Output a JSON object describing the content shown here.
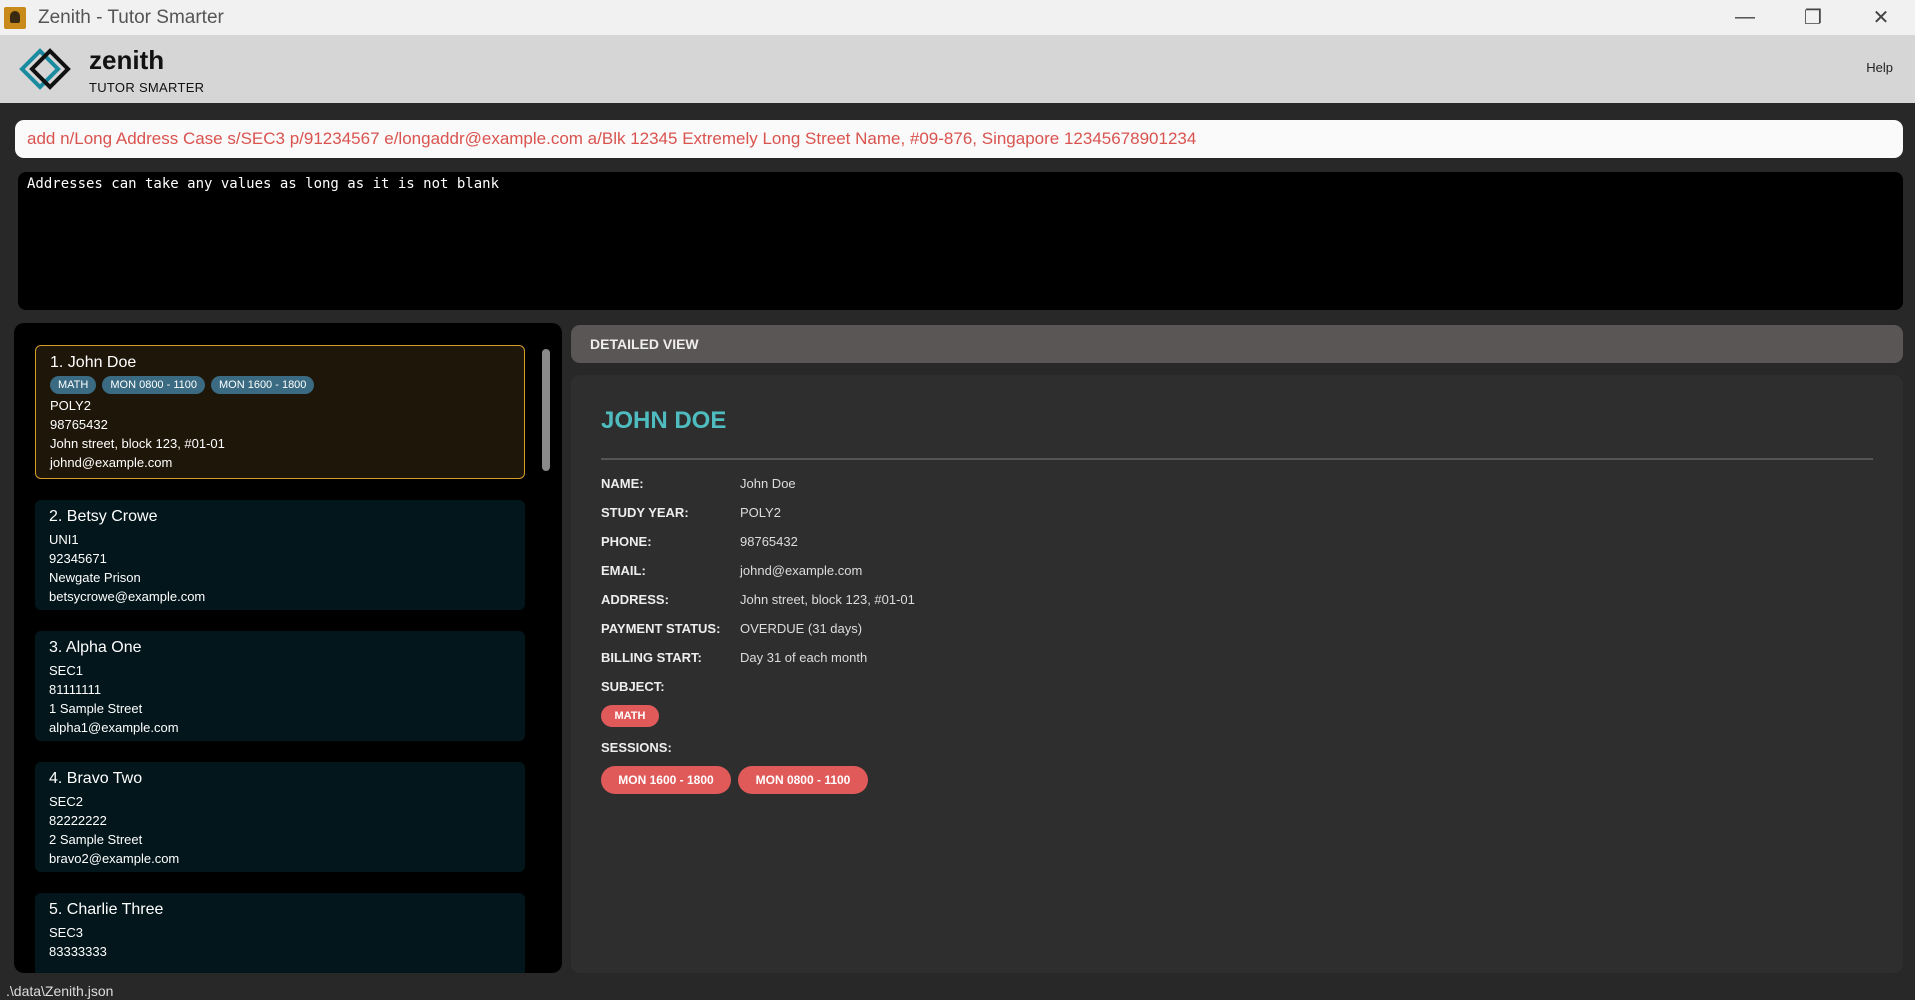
{
  "window": {
    "title": "Zenith - Tutor Smarter",
    "minimize_icon": "minimize-icon",
    "maximize_icon": "restore-icon",
    "close_icon": "close-icon"
  },
  "header": {
    "brand": "zenith",
    "tagline": "TUTOR SMARTER",
    "help": "Help"
  },
  "command_box": {
    "value": "add n/Long Address Case s/SEC3 p/91234567 e/longaddr@example.com a/Blk 12345 Extremely Long Street Name, #09-876, Singapore 12345678901234"
  },
  "result_display": {
    "message": "Addresses can take any values as long as it is not blank"
  },
  "person_list": [
    {
      "name": "1. John Doe",
      "tags": [
        "MATH",
        "MON 0800 - 1100",
        "MON 1600 - 1800"
      ],
      "study_year": "POLY2",
      "phone": "98765432",
      "address": "John street, block 123, #01-01",
      "email": "johnd@example.com",
      "selected": true
    },
    {
      "name": "2. Betsy Crowe",
      "study_year": "UNI1",
      "phone": "92345671",
      "address": "Newgate Prison",
      "email": "betsycrowe@example.com"
    },
    {
      "name": "3. Alpha One",
      "study_year": "SEC1",
      "phone": "81111111",
      "address": "1 Sample Street",
      "email": "alpha1@example.com"
    },
    {
      "name": "4. Bravo Two",
      "study_year": "SEC2",
      "phone": "82222222",
      "address": "2 Sample Street",
      "email": "bravo2@example.com"
    },
    {
      "name": "5. Charlie Three",
      "study_year": "SEC3",
      "phone": "83333333"
    }
  ],
  "detail": {
    "header": "DETAILED VIEW",
    "title": "JOHN DOE",
    "labels": {
      "name": "NAME:",
      "study_year": "STUDY YEAR:",
      "phone": "PHONE:",
      "email": "EMAIL:",
      "address": "ADDRESS:",
      "payment_status": "PAYMENT STATUS:",
      "billing_start": "BILLING START:",
      "subject": "SUBJECT:",
      "sessions": "SESSIONS:"
    },
    "values": {
      "name": "John Doe",
      "study_year": "POLY2",
      "phone": "98765432",
      "email": "johnd@example.com",
      "address": "John street, block 123, #01-01",
      "payment_status": "OVERDUE (31 days)",
      "billing_start": "Day 31 of each month"
    },
    "subjects": [
      "MATH"
    ],
    "sessions": [
      "MON 1600 - 1800",
      "MON 0800 - 1100"
    ]
  },
  "footer": {
    "file_path": ".\\data\\Zenith.json"
  },
  "colors": {
    "accent_teal": "#4fbcc0",
    "pill_red": "#e05a5a",
    "command_text": "#d9534f",
    "selected_border": "#d49e2a"
  }
}
